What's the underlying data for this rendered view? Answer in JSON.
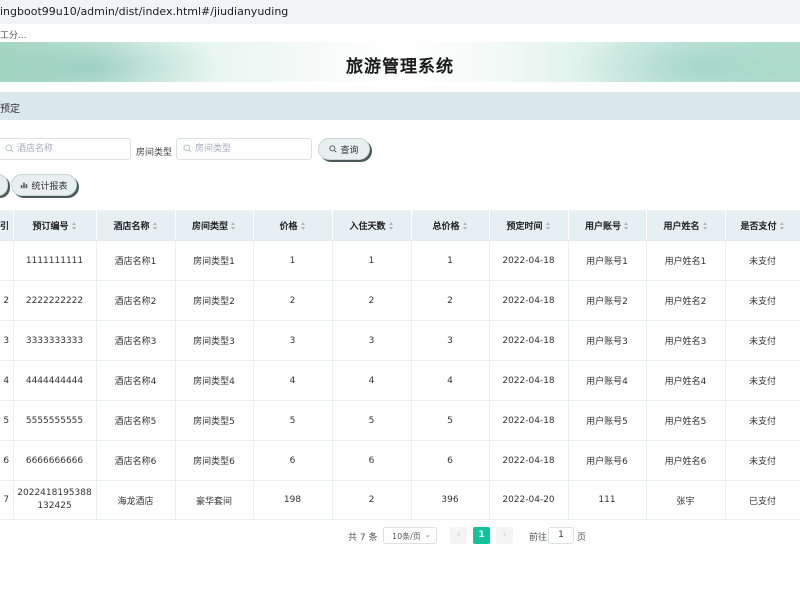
{
  "browser": {
    "url": "ingboot99u10/admin/dist/index.html#/jiudianyuding",
    "bookmark": "工分..."
  },
  "header": {
    "title": "旅游管理系统"
  },
  "breadcrumb": {
    "text": "预定"
  },
  "search": {
    "hotel_placeholder": "酒店名称",
    "room_type_label": "房间类型",
    "room_type_placeholder": "房间类型",
    "query_button": "查询",
    "stats_button": "统计报表"
  },
  "table": {
    "columns": [
      "引",
      "预订编号",
      "酒店名称",
      "房间类型",
      "价格",
      "入住天数",
      "总价格",
      "预定时间",
      "用户账号",
      "用户姓名",
      "是否支付"
    ],
    "rows": [
      {
        "idx": "",
        "order_no": "1111111111",
        "hotel": "酒店名称1",
        "room_type": "房间类型1",
        "price": "1",
        "days": "1",
        "total": "1",
        "date": "2022-04-18",
        "account": "用户账号1",
        "name": "用户姓名1",
        "paid": "未支付"
      },
      {
        "idx": "2",
        "order_no": "2222222222",
        "hotel": "酒店名称2",
        "room_type": "房间类型2",
        "price": "2",
        "days": "2",
        "total": "2",
        "date": "2022-04-18",
        "account": "用户账号2",
        "name": "用户姓名2",
        "paid": "未支付"
      },
      {
        "idx": "3",
        "order_no": "3333333333",
        "hotel": "酒店名称3",
        "room_type": "房间类型3",
        "price": "3",
        "days": "3",
        "total": "3",
        "date": "2022-04-18",
        "account": "用户账号3",
        "name": "用户姓名3",
        "paid": "未支付"
      },
      {
        "idx": "4",
        "order_no": "4444444444",
        "hotel": "酒店名称4",
        "room_type": "房间类型4",
        "price": "4",
        "days": "4",
        "total": "4",
        "date": "2022-04-18",
        "account": "用户账号4",
        "name": "用户姓名4",
        "paid": "未支付"
      },
      {
        "idx": "5",
        "order_no": "5555555555",
        "hotel": "酒店名称5",
        "room_type": "房间类型5",
        "price": "5",
        "days": "5",
        "total": "5",
        "date": "2022-04-18",
        "account": "用户账号5",
        "name": "用户姓名5",
        "paid": "未支付"
      },
      {
        "idx": "6",
        "order_no": "6666666666",
        "hotel": "酒店名称6",
        "room_type": "房间类型6",
        "price": "6",
        "days": "6",
        "total": "6",
        "date": "2022-04-18",
        "account": "用户账号6",
        "name": "用户姓名6",
        "paid": "未支付"
      },
      {
        "idx": "7",
        "order_no": "2022418195388132425",
        "hotel": "海龙酒店",
        "room_type": "豪华套间",
        "price": "198",
        "days": "2",
        "total": "396",
        "date": "2022-04-20",
        "account": "111",
        "name": "张宇",
        "paid": "已支付"
      }
    ]
  },
  "pagination": {
    "total": "共 7 条",
    "page_size": "10条/页",
    "prev": "‹",
    "current": "1",
    "next": "›",
    "goto_label": "前往",
    "goto_value": "1",
    "page_suffix": "页"
  },
  "colors": {
    "accent": "#13c29b",
    "header_bg": "#e6f0f2",
    "breadcrumb_bg": "#dbe9ec"
  }
}
